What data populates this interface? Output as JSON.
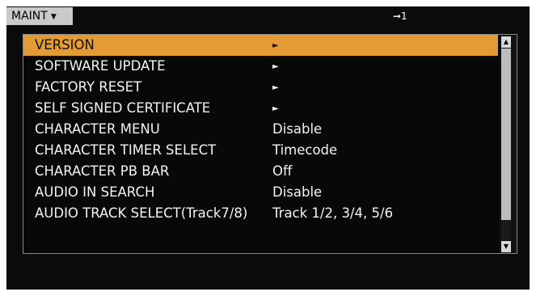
{
  "header": {
    "menu_tab": "MAINT",
    "menu_caret": "▼",
    "page_indicator": "➞1"
  },
  "menu": {
    "items": [
      {
        "label": "VERSION",
        "value": "►",
        "selected": true
      },
      {
        "label": "SOFTWARE UPDATE",
        "value": "►"
      },
      {
        "label": "FACTORY RESET",
        "value": "►"
      },
      {
        "label": "SELF SIGNED CERTIFICATE",
        "value": "►"
      },
      {
        "label": "CHARACTER MENU",
        "value": "Disable"
      },
      {
        "label": "CHARACTER TIMER SELECT",
        "value": "Timecode"
      },
      {
        "label": "CHARACTER PB BAR",
        "value": "Off"
      },
      {
        "label": "AUDIO IN SEARCH",
        "value": "Disable"
      },
      {
        "label": "AUDIO TRACK SELECT(Track7/8)",
        "value": "Track 1/2, 3/4, 5/6"
      }
    ]
  },
  "scrollbar": {
    "up_icon": "▲",
    "down_icon": "▼"
  },
  "colors": {
    "selection": "#e39b35",
    "background": "#0b0b0b",
    "text": "#f2f2f2"
  }
}
